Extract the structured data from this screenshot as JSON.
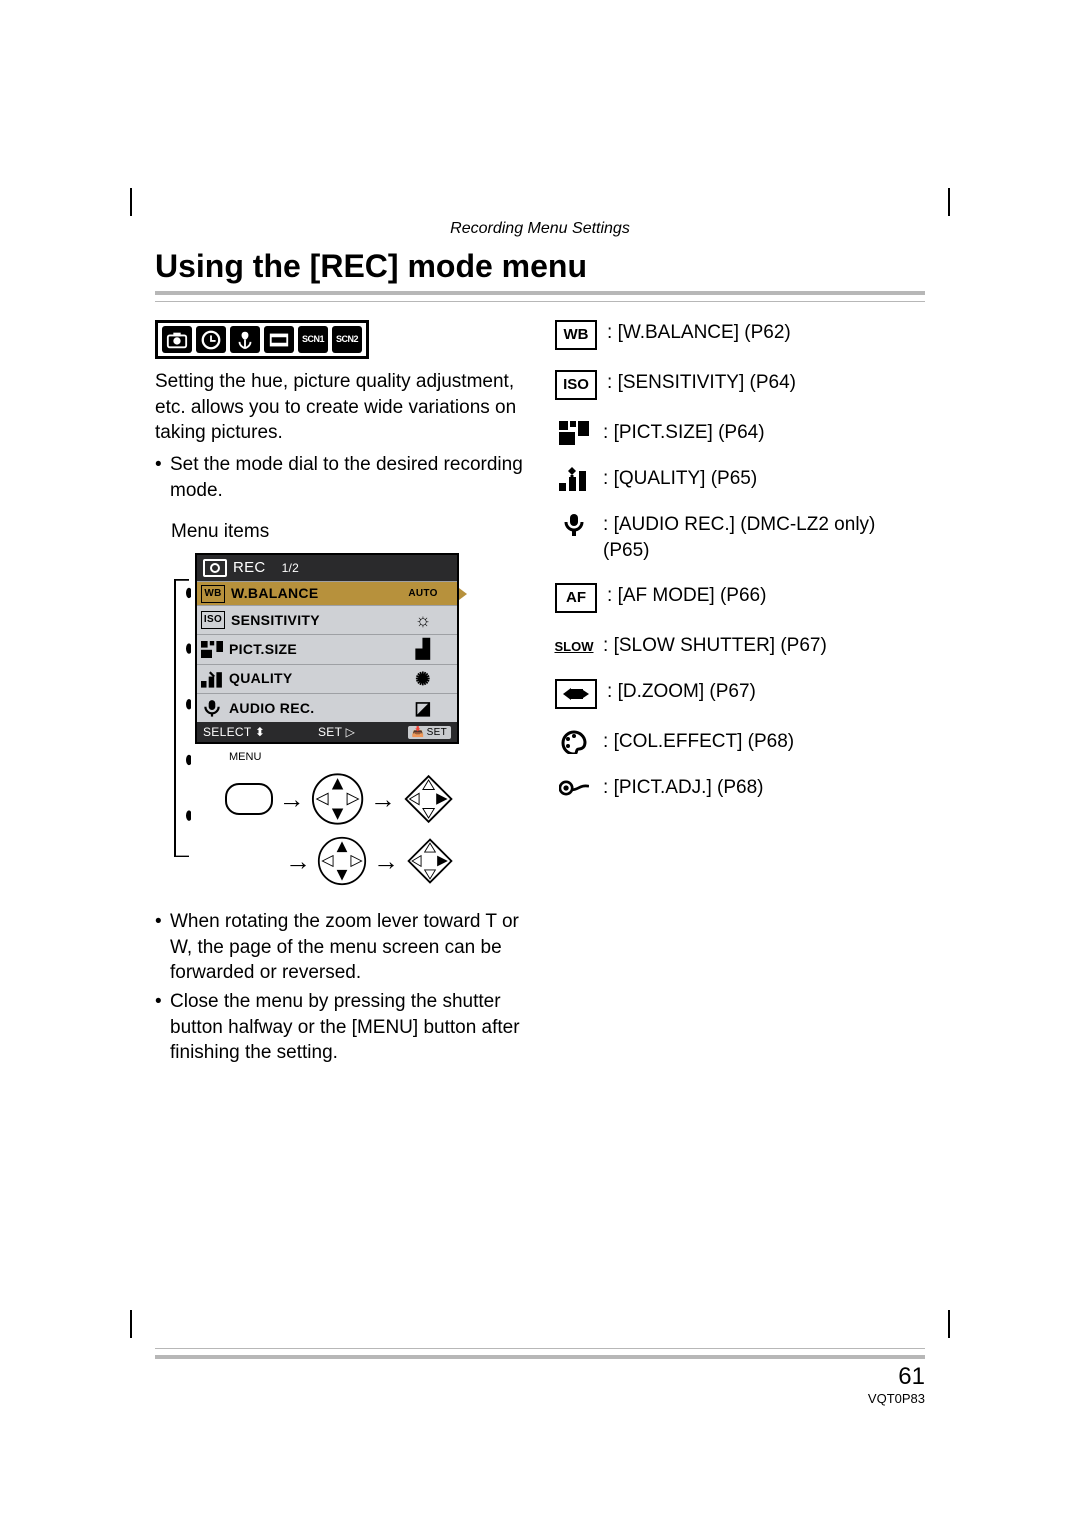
{
  "header": {
    "section_title": "Recording Menu Settings"
  },
  "title": "Using the [REC] mode menu",
  "mode_icons": [
    {
      "name": "camera-icon"
    },
    {
      "name": "simple-icon"
    },
    {
      "name": "macro-icon"
    },
    {
      "name": "motion-icon"
    },
    {
      "name": "scn1-icon",
      "label": "SCN1"
    },
    {
      "name": "scn2-icon",
      "label": "SCN2"
    }
  ],
  "intro": "Setting the hue, picture quality adjustment, etc. allows you to create wide variations on taking pictures.",
  "bullets_top": [
    "Set the mode dial to the desired recording mode."
  ],
  "menu_items_label": "Menu items",
  "lcd": {
    "title": "REC",
    "page": "1/2",
    "rows": [
      {
        "icon": "WB",
        "label": "W.BALANCE",
        "value": "AUTO",
        "highlight": true
      },
      {
        "icon": "ISO",
        "label": "SENSITIVITY",
        "value_sym": "☼"
      },
      {
        "icon": "PS",
        "label": "PICT.SIZE",
        "value_sym": "▟"
      },
      {
        "icon": "Q",
        "label": "QUALITY",
        "value_sym": "✺"
      },
      {
        "icon": "MIC",
        "label": "AUDIO REC.",
        "value_sym": "◪"
      }
    ],
    "footer_select": "SELECT",
    "footer_set": "SET",
    "footer_set_chip": "SET",
    "menu_label": "MENU"
  },
  "bullets_bottom": [
    "When rotating the zoom lever toward T or W, the page of the menu screen can be forwarded or reversed.",
    "Close the menu by pressing the shutter button halfway or the [MENU] button after finishing the setting."
  ],
  "references": [
    {
      "icon": "WB",
      "boxed": true,
      "text": "[W.BALANCE] (P62)"
    },
    {
      "icon": "ISO",
      "boxed": true,
      "text": "[SENSITIVITY] (P64)"
    },
    {
      "icon": "grid",
      "boxed": false,
      "text": "[PICT.SIZE] (P64)"
    },
    {
      "icon": "qual",
      "boxed": false,
      "text": "[QUALITY] (P65)"
    },
    {
      "icon": "mic",
      "boxed": false,
      "text": "[AUDIO REC.] (DMC-LZ2 only) (P65)"
    },
    {
      "icon": "AF",
      "boxed": true,
      "text": "[AF MODE] (P66)"
    },
    {
      "icon": "SLOW",
      "boxed": false,
      "text": "[SLOW SHUTTER] (P67)"
    },
    {
      "icon": "dzoom",
      "boxed": true,
      "text": "[D.ZOOM] (P67)"
    },
    {
      "icon": "pal",
      "boxed": false,
      "text": "[COL.EFFECT] (P68)"
    },
    {
      "icon": "padj",
      "boxed": false,
      "text": "[PICT.ADJ.] (P68)"
    }
  ],
  "footer": {
    "page_number": "61",
    "doc_code": "VQT0P83"
  }
}
